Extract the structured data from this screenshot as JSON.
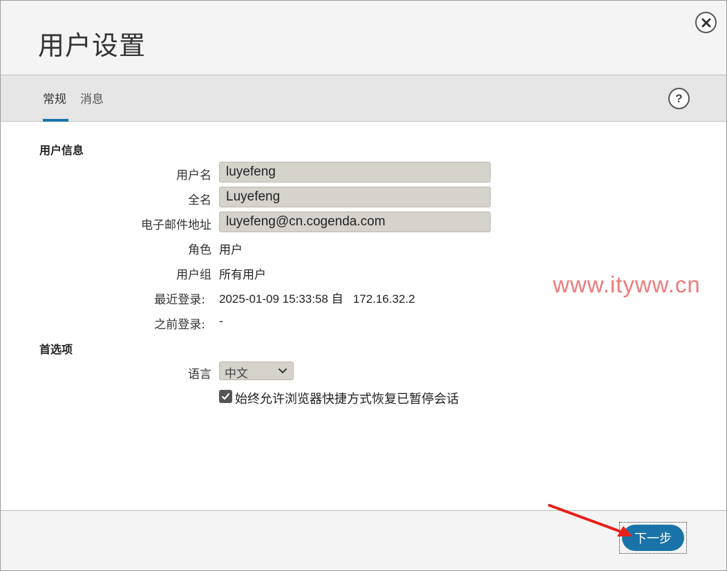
{
  "dialog": {
    "title": "用户设置"
  },
  "tabs": [
    {
      "label": "常规",
      "active": true
    },
    {
      "label": "消息",
      "active": false
    }
  ],
  "user_info": {
    "heading": "用户信息",
    "username_label": "用户名",
    "username_value": "luyefeng",
    "fullname_label": "全名",
    "fullname_value": "Luyefeng",
    "email_label": "电子邮件地址",
    "email_value": "luyefeng@cn.cogenda.com",
    "role_label": "角色",
    "role_value": "用户",
    "group_label": "用户组",
    "group_value": "所有用户",
    "last_login_label": "最近登录:",
    "last_login_value": "2025-01-09 15:33:58 自   172.16.32.2",
    "prev_login_label": "之前登录:",
    "prev_login_value": "-"
  },
  "preferences": {
    "heading": "首选项",
    "language_label": "语言",
    "language_selected": "中文",
    "restore_sessions_label": "始终允许浏览器快捷方式恢复已暂停会话",
    "restore_sessions_checked": true
  },
  "watermark": "www.ityww.cn",
  "footer": {
    "next_label": "下一步"
  },
  "colors": {
    "accent": "#1a73a8",
    "field_bg": "#d6d2cc",
    "annotation_arrow": "#e8201a",
    "watermark": "#ee7a7a"
  },
  "icons": {
    "close": "close-icon",
    "help": "help-icon",
    "select_chevron": "chevron-down-icon",
    "checkbox": "check-icon"
  }
}
